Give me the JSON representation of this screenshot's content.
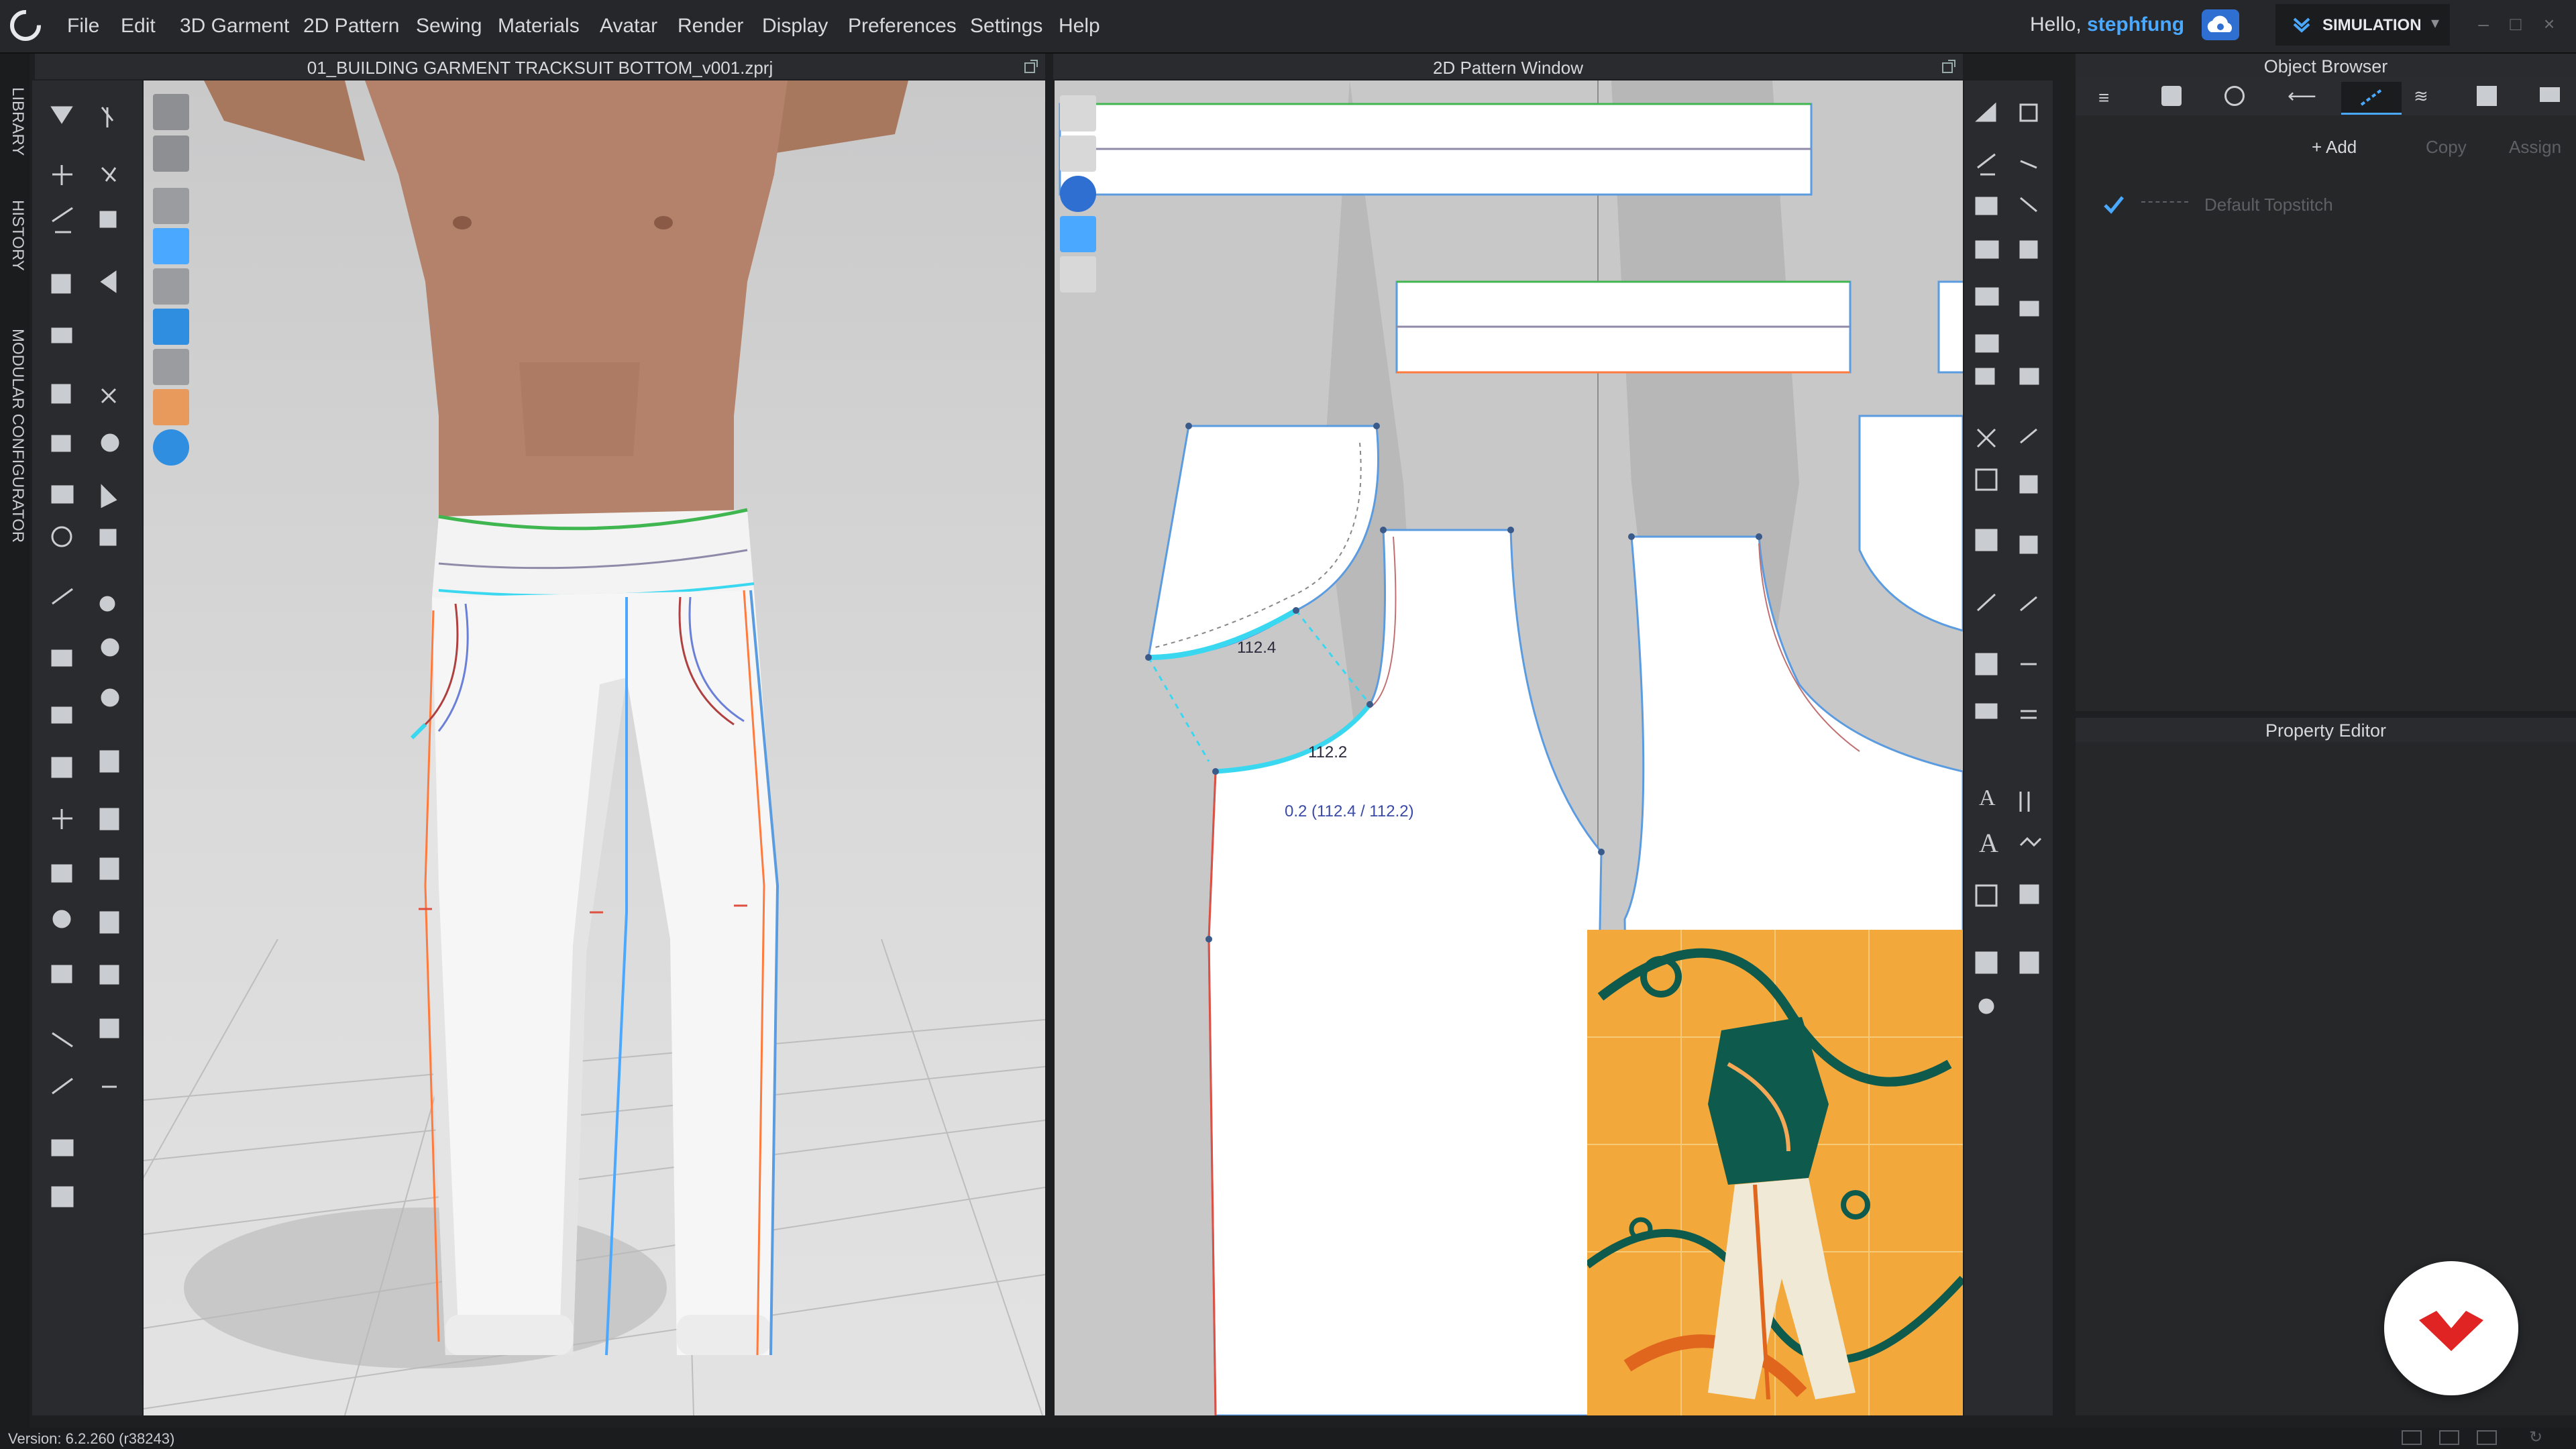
{
  "menu": {
    "items": [
      "File",
      "Edit",
      "3D Garment",
      "2D Pattern",
      "Sewing",
      "Materials",
      "Avatar",
      "Render",
      "Display",
      "Preferences",
      "Settings",
      "Help"
    ],
    "greeting_prefix": "Hello,",
    "username": "stephfung",
    "mode_label": "SIMULATION"
  },
  "side_tabs": [
    "LIBRARY",
    "HISTORY",
    "MODULAR CONFIGURATOR"
  ],
  "viewport3d": {
    "title": "01_BUILDING GARMENT TRACKSUIT BOTTOM_v001.zprj"
  },
  "viewport2d": {
    "title": "2D Pattern Window",
    "measure_a": "112.4",
    "measure_b": "112.2",
    "measure_diff": "0.2 (112.4 / 112.2)"
  },
  "object_browser": {
    "title": "Object Browser",
    "add_label": "+ Add",
    "copy_label": "Copy",
    "assign_label": "Assign",
    "topstitch_item": "Default Topstitch"
  },
  "property_editor": {
    "title": "Property Editor"
  },
  "status": {
    "version": "Version: 6.2.260 (r38243)"
  },
  "colors": {
    "accent_blue": "#4aa8ff",
    "brand_red": "#e02424",
    "seam_cyan": "#39d8f0",
    "outline_blue": "#5b9be0"
  }
}
